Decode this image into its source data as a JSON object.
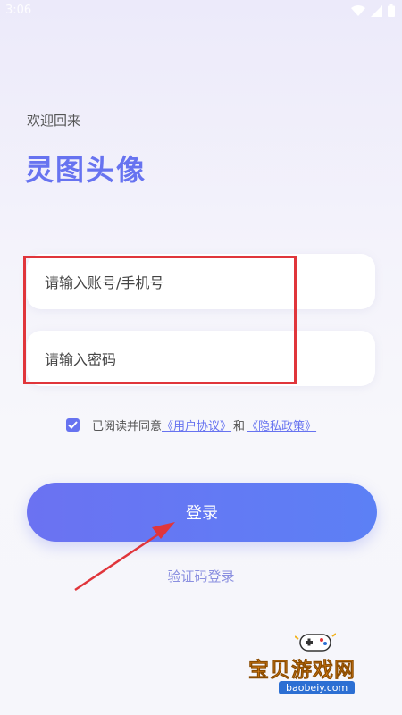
{
  "status_bar": {
    "time": "3:06"
  },
  "header": {
    "welcome": "欢迎回来",
    "title": "灵图头像"
  },
  "form": {
    "account_placeholder": "请输入账号/手机号",
    "password_placeholder": "请输入密码"
  },
  "agreement": {
    "text": "已阅读并同意",
    "user_agreement": "《用户协议》",
    "and": "和",
    "privacy_policy": "《隐私政策》",
    "checked": true
  },
  "actions": {
    "login": "登录",
    "code_login": "验证码登录"
  },
  "watermark": {
    "name": "宝贝游戏网",
    "url": "baobeiy.com"
  },
  "colors": {
    "accent": "#6773F0",
    "highlight": "#E0353B",
    "button_start": "#6B72F2",
    "button_end": "#5C80F5"
  }
}
